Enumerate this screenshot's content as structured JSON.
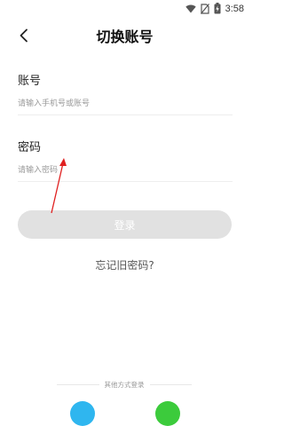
{
  "status_bar": {
    "time": "3:58",
    "icons": [
      "wifi-icon",
      "no-sim-icon",
      "battery-charging-icon"
    ]
  },
  "header": {
    "back_icon": "chevron-left-icon",
    "title": "切换账号"
  },
  "account": {
    "label": "账号",
    "placeholder": "请输入手机号或账号",
    "value": ""
  },
  "password": {
    "label": "密码",
    "placeholder": "请输入密码",
    "value": ""
  },
  "login_button": {
    "label": "登录",
    "color": "#e1e1e1"
  },
  "forgot_link": "忘记旧密码?",
  "other_login": {
    "label": "其他方式登录",
    "options": [
      {
        "icon": "blue-circle-login-icon",
        "color": "#2fb6ef"
      },
      {
        "icon": "green-circle-login-icon",
        "color": "#3ccb3c"
      }
    ]
  },
  "annotation": {
    "icon": "red-arrow-icon",
    "color": "#e02020"
  }
}
